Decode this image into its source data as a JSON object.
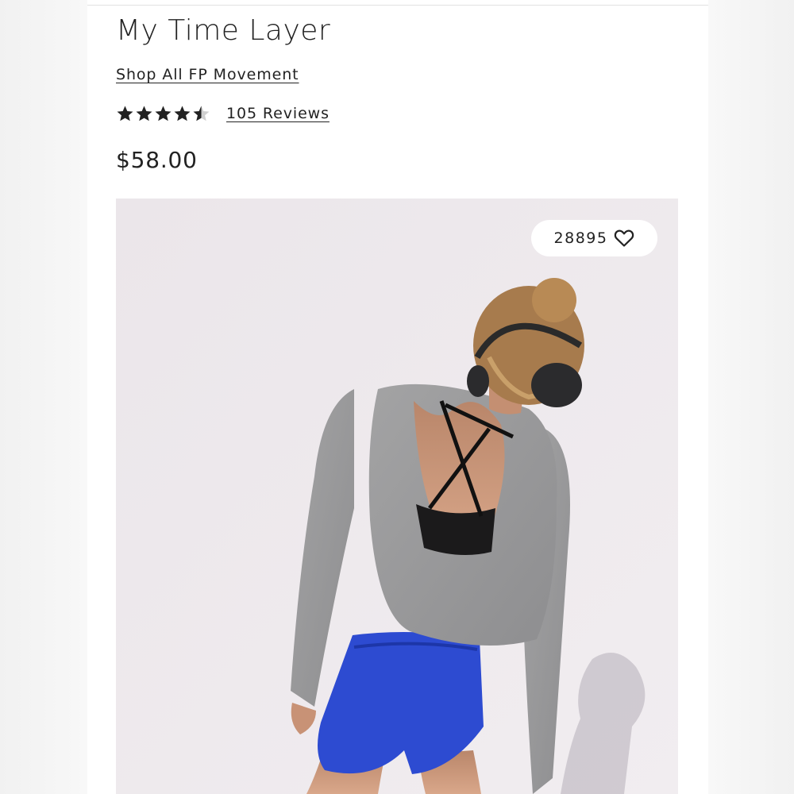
{
  "product": {
    "title": "My Time Layer",
    "shop_link": "Shop All FP Movement",
    "rating": 4.5,
    "reviews_label": "105 Reviews",
    "price": "$58.00"
  },
  "gallery": {
    "favorites_count": "28895",
    "favorite_icon": "heart-outline-icon",
    "image_description_icon": "product-photo"
  },
  "colors": {
    "text": "#222222",
    "star": "#222222",
    "photo_background": "#ece7ea"
  }
}
